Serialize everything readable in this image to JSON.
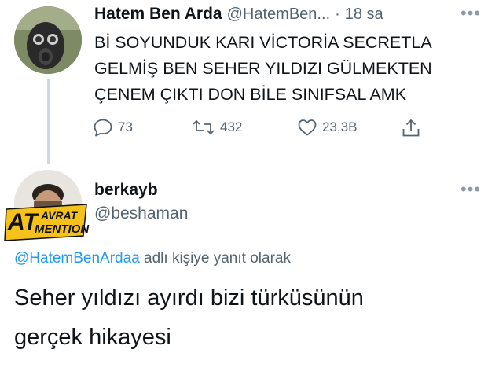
{
  "original": {
    "author_name": "Hatem Ben Arda",
    "handle": "@HatemBen...",
    "separator": "·",
    "time": "18 sa",
    "text_lines": [
      "Bİ SOYUNDUK KARI VİCTORİA SECRETLA",
      "GELMİŞ BEN SEHER YILDIZI GÜLMEKTEN",
      "ÇENEM ÇIKTI DON BİLE SINIFSAL AMK"
    ],
    "replies": "73",
    "retweets": "432",
    "likes": "23,3B",
    "icons": [
      "gas-mask-avatar",
      "more-icon",
      "reply-icon",
      "retweet-icon",
      "like-icon",
      "share-icon"
    ]
  },
  "reply": {
    "author_name": "berkayb",
    "handle": "@beshaman",
    "badge": {
      "big": "AT",
      "line1": "AVRAT",
      "line2": "MENTION"
    },
    "replying_to_handle": "@HatemBenArdaa",
    "replying_to_suffix": " adlı kişiye yanıt olarak",
    "text_lines": [
      "Seher yıldızı ayırdı bizi türküsünün",
      "gerçek hikayesi"
    ],
    "icons": [
      "user-avatar",
      "more-icon"
    ]
  },
  "colors": {
    "accent": "#1d9bf0",
    "muted": "#536471",
    "badge": "#f4c21a"
  }
}
